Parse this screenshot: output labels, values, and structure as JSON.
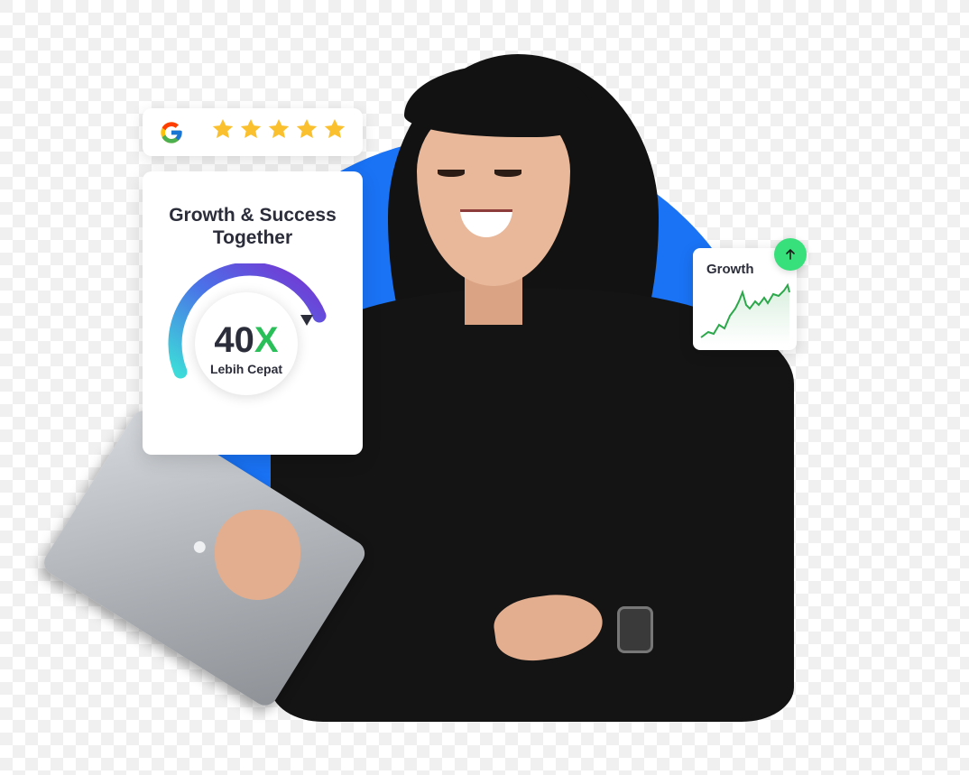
{
  "rating": {
    "logo": "google-g-icon",
    "stars": 5,
    "star_color": "#FBC02D"
  },
  "growth_card": {
    "title_line1": "Growth & Success",
    "title_line2": "Together",
    "value_number": "40",
    "value_suffix": "X",
    "caption": "Lebih Cepat",
    "accent_green": "#2BBF5A"
  },
  "mini_card": {
    "title": "Growth",
    "badge_icon": "arrow-up-icon",
    "badge_color": "#37E07A",
    "line_color": "#2BA84A"
  },
  "colors": {
    "circle_blue": "#1A73F5",
    "text_dark": "#2B2D3A"
  }
}
